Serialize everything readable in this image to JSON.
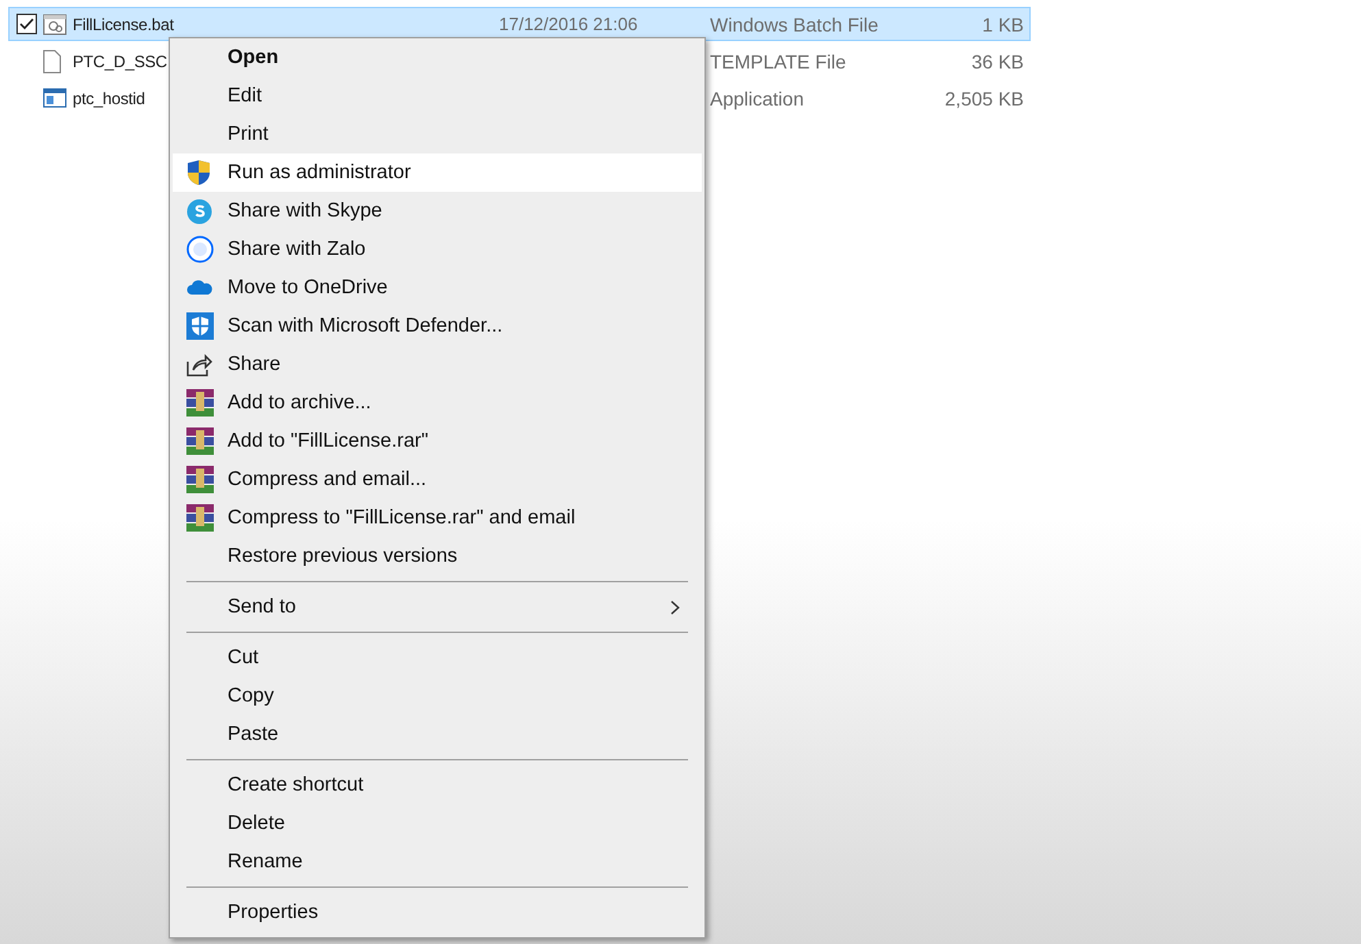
{
  "files": [
    {
      "name": "FillLicense.bat",
      "date": "17/12/2016 21:06",
      "type": "Windows Batch File",
      "size": "1 KB",
      "selected": true,
      "checked": true,
      "kind": "batch"
    },
    {
      "name": "PTC_D_SSC",
      "type": "TEMPLATE File",
      "size": "36 KB",
      "selected": false,
      "checked": false,
      "kind": "document"
    },
    {
      "name": "ptc_hostid",
      "type": "Application",
      "size": "2,505 KB",
      "selected": false,
      "checked": false,
      "kind": "application"
    }
  ],
  "context_menu": {
    "items": [
      {
        "kind": "plain",
        "label": "Open",
        "default": true,
        "selected": false
      },
      {
        "kind": "plain",
        "label": "Edit",
        "default": false,
        "selected": false
      },
      {
        "kind": "plain",
        "label": "Print",
        "default": false,
        "selected": false
      },
      {
        "kind": "uac",
        "label": "Run as administrator",
        "default": false,
        "selected": true
      },
      {
        "kind": "skype",
        "label": "Share with Skype",
        "default": false,
        "selected": false
      },
      {
        "kind": "zalo",
        "label": "Share with Zalo",
        "default": false,
        "selected": false
      },
      {
        "kind": "onedrive",
        "label": "Move to OneDrive",
        "default": false,
        "selected": false
      },
      {
        "kind": "defender",
        "label": "Scan with Microsoft Defender...",
        "default": false,
        "selected": false
      },
      {
        "kind": "share",
        "label": "Share",
        "default": false,
        "selected": false
      },
      {
        "kind": "archive",
        "label": "Add to archive...",
        "default": false,
        "selected": false
      },
      {
        "kind": "archive",
        "label": "Add to \"FillLicense.rar\"",
        "default": false,
        "selected": false
      },
      {
        "kind": "archive",
        "label": "Compress and email...",
        "default": false,
        "selected": false
      },
      {
        "kind": "archive",
        "label": "Compress to \"FillLicense.rar\" and email",
        "default": false,
        "selected": false
      },
      {
        "kind": "plain",
        "label": "Restore previous versions",
        "default": false,
        "selected": false
      },
      {
        "kind": "separator"
      },
      {
        "kind": "submenu",
        "label": "Send to",
        "default": false,
        "selected": false
      },
      {
        "kind": "separator"
      },
      {
        "kind": "plain",
        "label": "Cut",
        "default": false,
        "selected": false
      },
      {
        "kind": "plain",
        "label": "Copy",
        "default": false,
        "selected": false
      },
      {
        "kind": "plain",
        "label": "Paste",
        "default": false,
        "selected": false
      },
      {
        "kind": "separator"
      },
      {
        "kind": "plain",
        "label": "Create shortcut",
        "default": false,
        "selected": false
      },
      {
        "kind": "plain",
        "label": "Delete",
        "default": false,
        "selected": false
      },
      {
        "kind": "plain",
        "label": "Rename",
        "default": false,
        "selected": false
      },
      {
        "kind": "separator"
      },
      {
        "kind": "plain",
        "label": "Properties",
        "default": false,
        "selected": false
      }
    ]
  }
}
